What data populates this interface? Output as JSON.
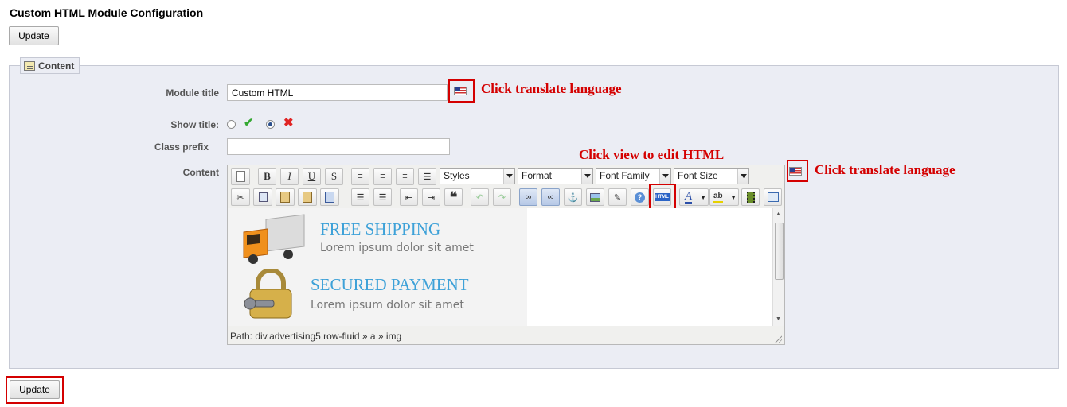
{
  "header": {
    "title": "Custom HTML Module Configuration",
    "update_label": "Update"
  },
  "fieldset": {
    "legend": "Content",
    "legend_icon": "edit-note-icon"
  },
  "form": {
    "module_title": {
      "label": "Module title",
      "value": "Custom HTML"
    },
    "show_title": {
      "label": "Show title:",
      "selected": "no"
    },
    "class_prefix": {
      "label": "Class prefix",
      "value": ""
    },
    "content": {
      "label": "Content"
    }
  },
  "annotations": {
    "translate_title": "Click translate language",
    "view_html": "Click view to edit HTML",
    "translate_content": "Click translate language"
  },
  "editor": {
    "toolbar_row1": {
      "bold": "B",
      "italic": "I",
      "underline": "U",
      "strikethrough": "S",
      "styles": "Styles",
      "format": "Format",
      "font_family": "Font Family",
      "font_size": "Font Size"
    },
    "toolbar_row2": {
      "blockquote": "❝",
      "html": "HTML",
      "text_color": "A",
      "highlight": "ab"
    },
    "content": {
      "promo1_title": "FREE SHIPPING",
      "promo1_text": "Lorem ipsum dolor sit amet",
      "promo2_title": "SECURED PAYMENT",
      "promo2_text": "Lorem ipsum dolor sit amet"
    },
    "path": "Path: div.advertising5 row-fluid » a » img"
  },
  "footer": {
    "update_label": "Update"
  },
  "colors": {
    "annotation": "#d40000",
    "fieldset_bg": "#ebedf4",
    "promo_title": "#3da1d8"
  }
}
